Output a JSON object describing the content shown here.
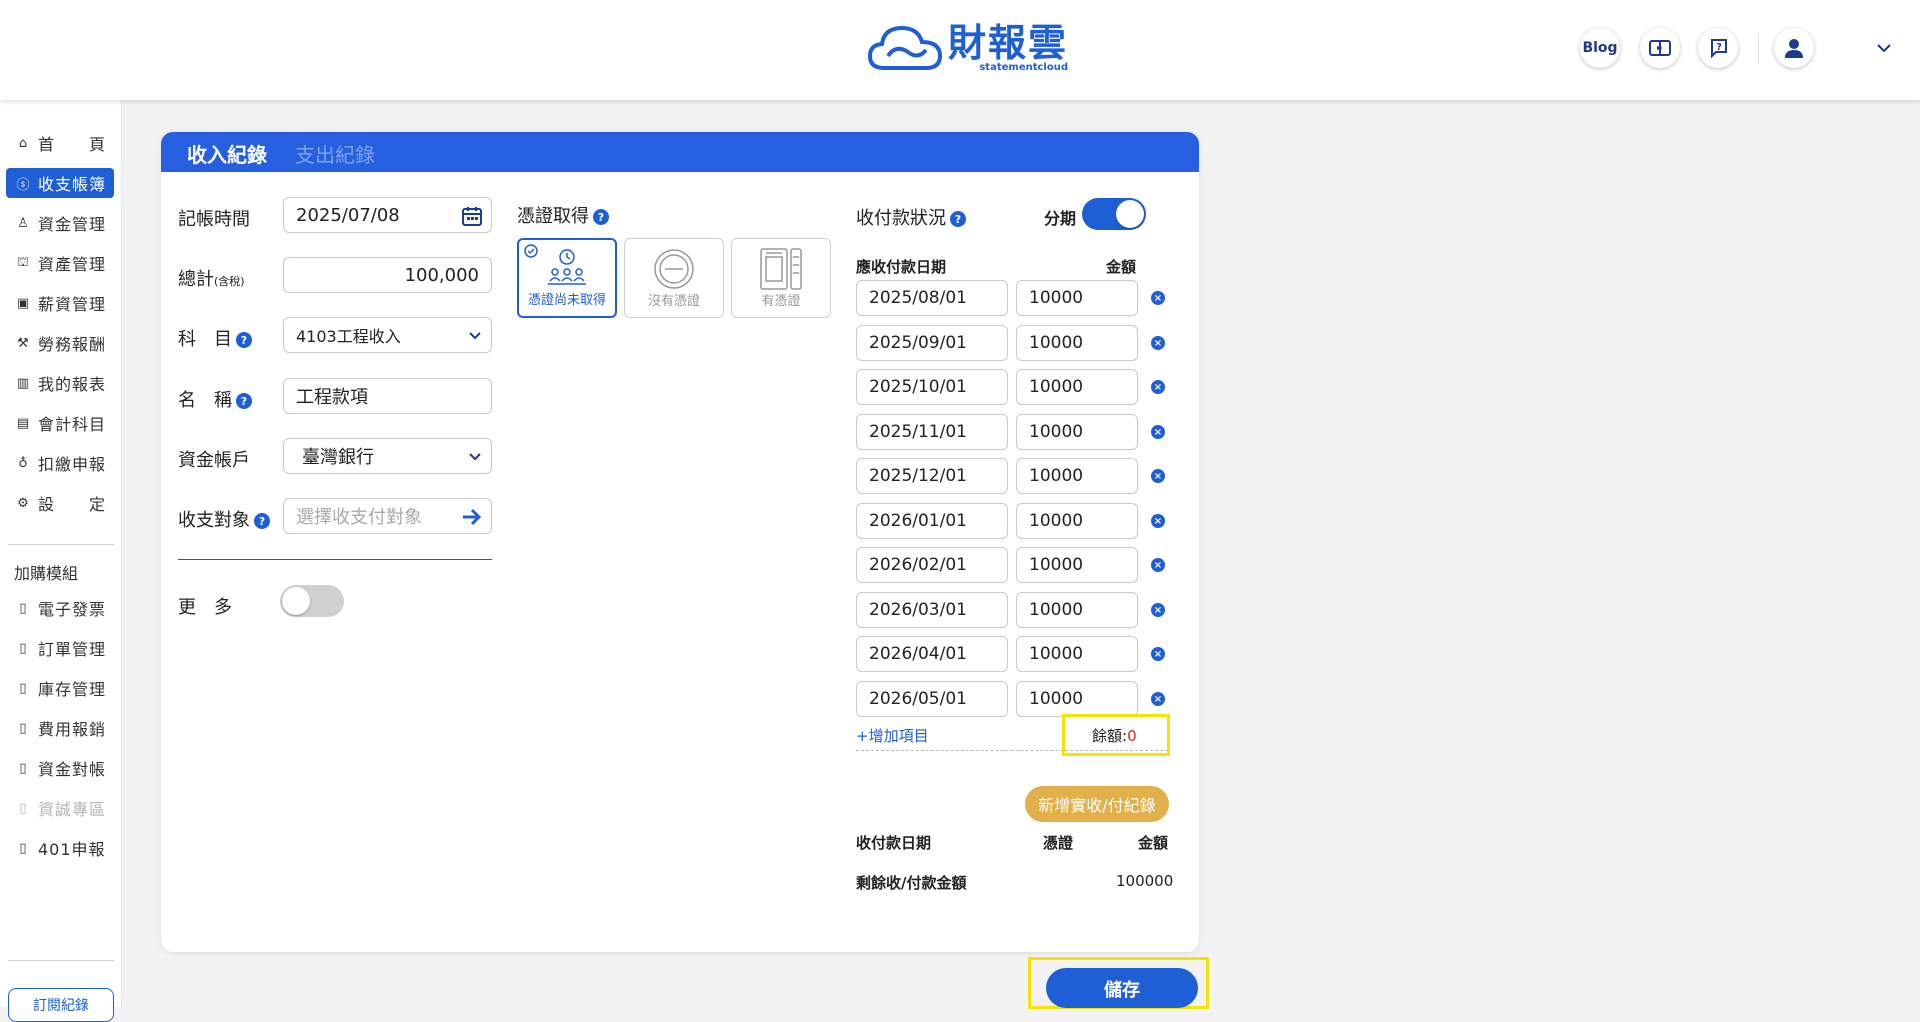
{
  "header": {
    "logo_text": "財報雲",
    "logo_sub": "statementcloud",
    "blog_label": "Blog"
  },
  "sidebar": {
    "items": [
      {
        "icon": "home-icon",
        "label": "首　　頁"
      },
      {
        "icon": "coin-icon",
        "label": "收支帳簿"
      },
      {
        "icon": "fund-icon",
        "label": "資金管理"
      },
      {
        "icon": "asset-icon",
        "label": "資產管理"
      },
      {
        "icon": "salary-icon",
        "label": "薪資管理"
      },
      {
        "icon": "labor-icon",
        "label": "勞務報酬"
      },
      {
        "icon": "report-icon",
        "label": "我的報表"
      },
      {
        "icon": "account-icon",
        "label": "會計科目"
      },
      {
        "icon": "tax-icon",
        "label": "扣繳申報"
      },
      {
        "icon": "settings-icon",
        "label": "設　　定"
      }
    ],
    "addon_heading": "加購模組",
    "addons": [
      "電子發票",
      "訂單管理",
      "庫存管理",
      "費用報銷",
      "資金對帳",
      "資誠專區",
      "401申報"
    ],
    "order_label": "訂閱紀錄"
  },
  "tabs": {
    "income": "收入紀錄",
    "expense": "支出紀錄"
  },
  "form": {
    "date_label": "記帳時間",
    "date_value": "2025/07/08",
    "total_label": "總計",
    "total_suffix": "(含稅)",
    "total_value": "100,000",
    "subject_label": "科　目",
    "subject_value": "4103工程收入",
    "name_label": "名　稱",
    "name_value": "工程款項",
    "fund_label": "資金帳戶",
    "fund_value": "臺灣銀行",
    "target_label": "收支對象",
    "target_placeholder": "選擇收支付對象",
    "more_label": "更　多"
  },
  "voucher": {
    "label": "憑證取得",
    "options": [
      "憑證尚未取得",
      "沒有憑證",
      "有憑證"
    ]
  },
  "payment": {
    "status_label": "收付款狀況",
    "installment_label": "分期",
    "col_date": "應收付款日期",
    "col_amount": "金額",
    "rows": [
      {
        "date": "2025/08/01",
        "amount": "10000"
      },
      {
        "date": "2025/09/01",
        "amount": "10000"
      },
      {
        "date": "2025/10/01",
        "amount": "10000"
      },
      {
        "date": "2025/11/01",
        "amount": "10000"
      },
      {
        "date": "2025/12/01",
        "amount": "10000"
      },
      {
        "date": "2026/01/01",
        "amount": "10000"
      },
      {
        "date": "2026/02/01",
        "amount": "10000"
      },
      {
        "date": "2026/03/01",
        "amount": "10000"
      },
      {
        "date": "2026/04/01",
        "amount": "10000"
      },
      {
        "date": "2026/05/01",
        "amount": "10000"
      }
    ],
    "add_item": "+增加項目",
    "balance_label": "餘額:",
    "balance_value": "0",
    "add_record": "新增實收/付紀錄",
    "actual_col_date": "收付款日期",
    "actual_col_voucher": "憑證",
    "actual_col_amount": "金額",
    "remaining_label": "剩餘收/付款金額",
    "remaining_value": "100000"
  },
  "save_label": "儲存",
  "colors": {
    "primary": "#1e5fd6",
    "gold": "#e2b04a",
    "highlight": "#f4e400",
    "balance": "#e02020"
  }
}
